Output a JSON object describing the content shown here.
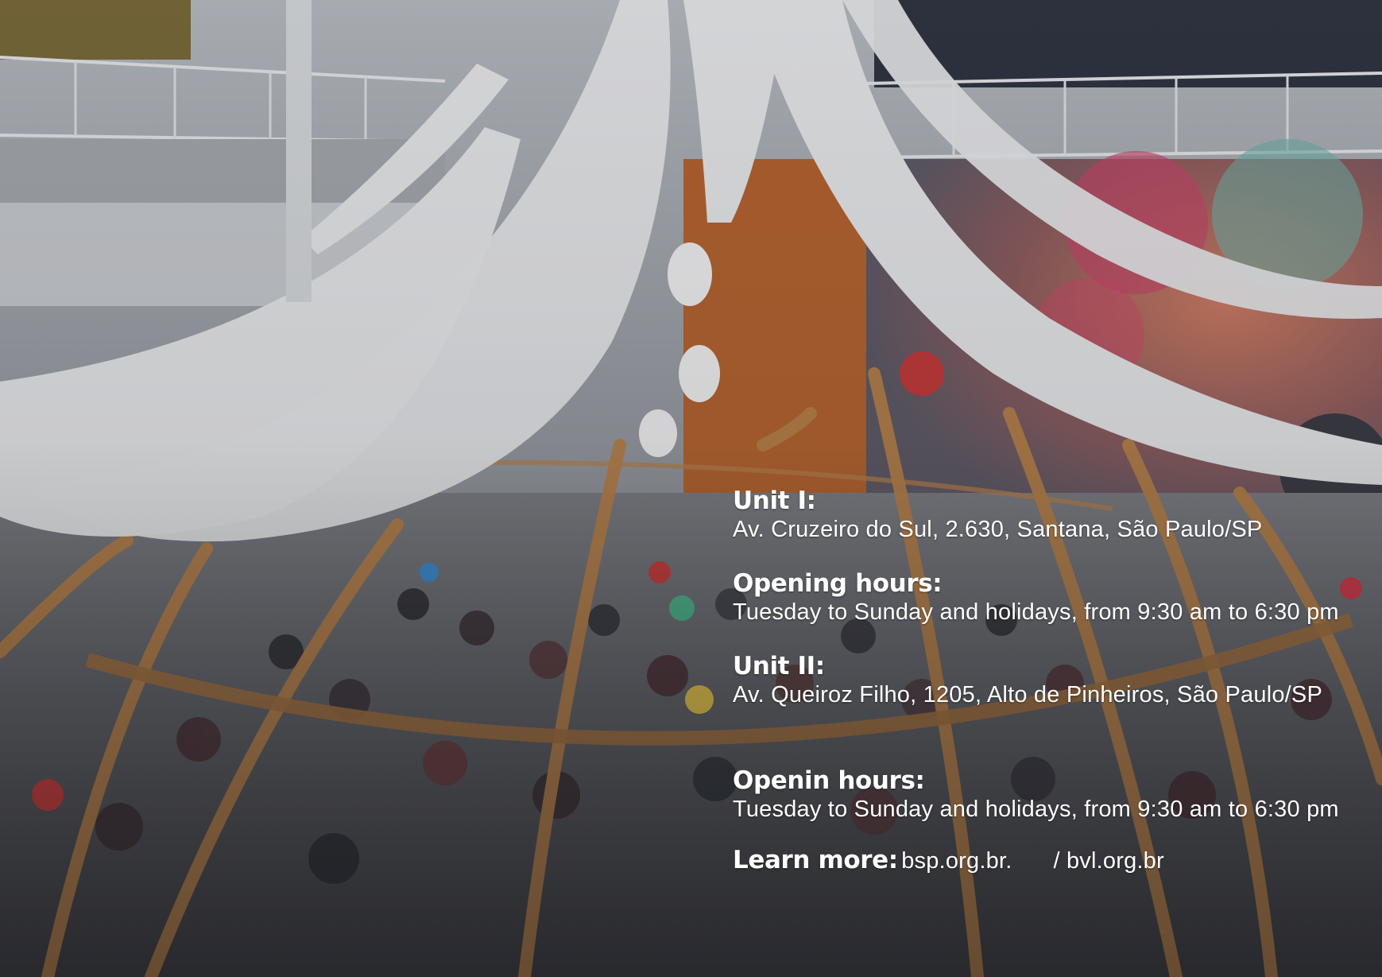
{
  "info": {
    "unit1_label": "Unit I:",
    "unit1_address": "Av. Cruzeiro do Sul, 2.630, Santana, São Paulo/SP",
    "hours1_label": "Opening hours:",
    "hours1_value": "Tuesday to Sunday and holidays, from 9:30 am to 6:30 pm",
    "unit2_label": "Unit II:",
    "unit2_address": "Av. Queiroz Filho, 1205, Alto de Pinheiros, São Paulo/SP",
    "hours2_label": "Openin hours:",
    "hours2_value": "Tuesday to Sunday and holidays, from 9:30 am to 6:30 pm",
    "learn_label": "Learn more:",
    "link1": "bsp.org.br.",
    "link2": "/ bvl.org.br"
  },
  "colors": {
    "text": "#ffffff",
    "wood": "#b9824a",
    "fabric": "#e9eaec",
    "orange_wall": "#b6642f"
  }
}
